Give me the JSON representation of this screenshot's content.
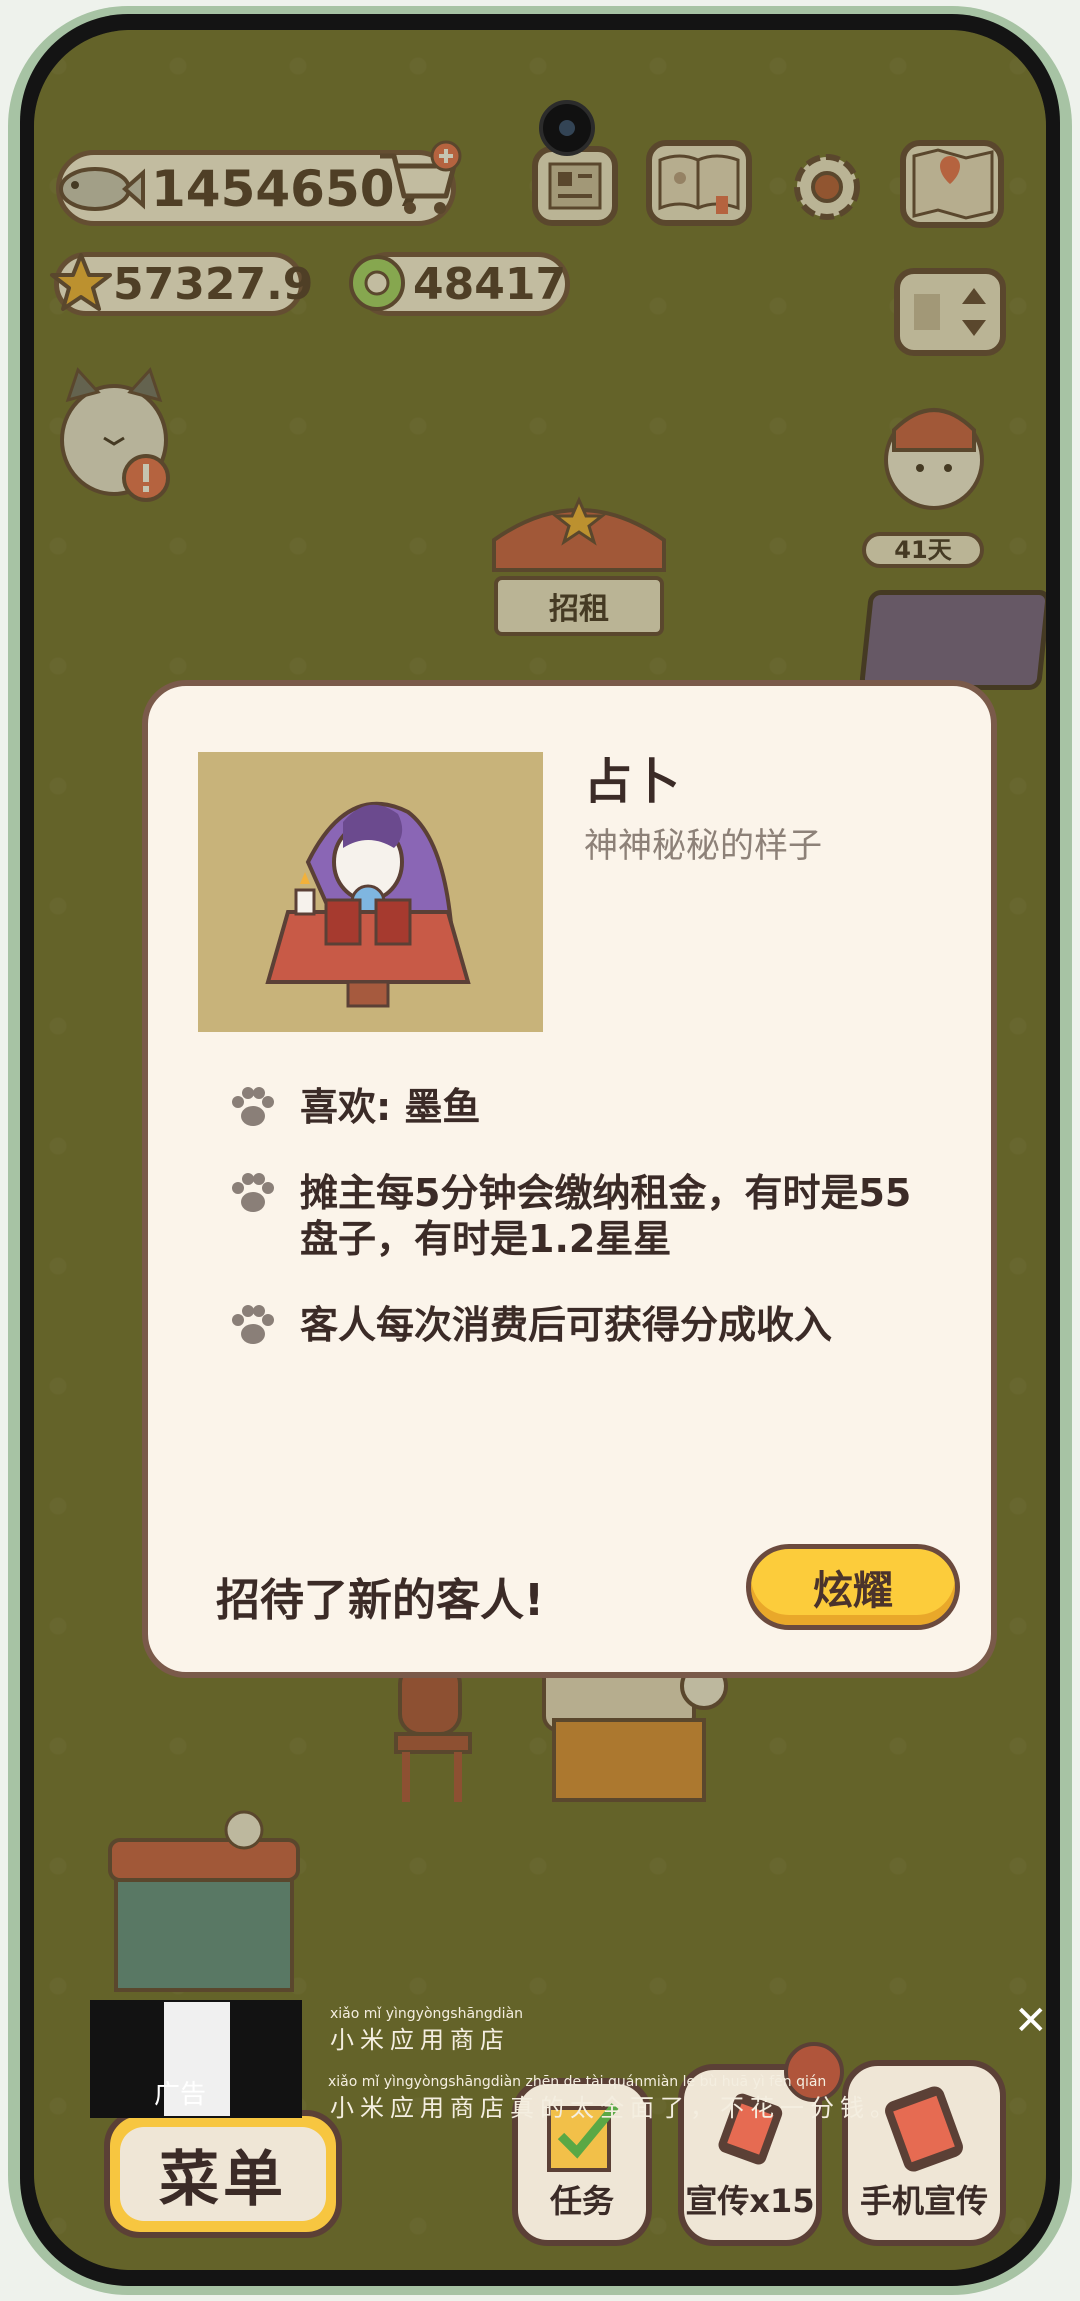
{
  "hud": {
    "fish": "14546507",
    "stars": "57327.9",
    "coins": "48417"
  },
  "scene": {
    "stall_sign": "招租",
    "days_badge": "41天"
  },
  "dialog": {
    "title": "占卜",
    "subtitle": "神神秘秘的样子",
    "features": [
      "喜欢: 墨鱼",
      "摊主每5分钟会缴纳租金，有时是55盘子，有时是1.2星星",
      "客人每次消费后可获得分成收入"
    ],
    "footer": "招待了新的客人!",
    "show_button": "炫耀"
  },
  "bottom_bar": {
    "menu": "菜单",
    "task": "任务",
    "promote": "宣传x15",
    "phone_promote": "手机宣传"
  },
  "ad": {
    "label": "广告",
    "pinyin1": "xiǎo mǐ yìngyòngshāngdiàn",
    "line1": "小米应用商店",
    "pinyin2": "xiǎo mǐ yìngyòngshāngdiàn zhēn de  tài quánmiàn  le       bù  huā  yì  fēn qián",
    "line2": "小米应用商店真的太全面了，不花一分钱。",
    "close": "✕"
  },
  "colors": {
    "background": "#6b6a31",
    "dialog_bg": "#fbf4ea",
    "button_yellow": "#fccc3b",
    "border_brown": "#6b4a3e"
  }
}
